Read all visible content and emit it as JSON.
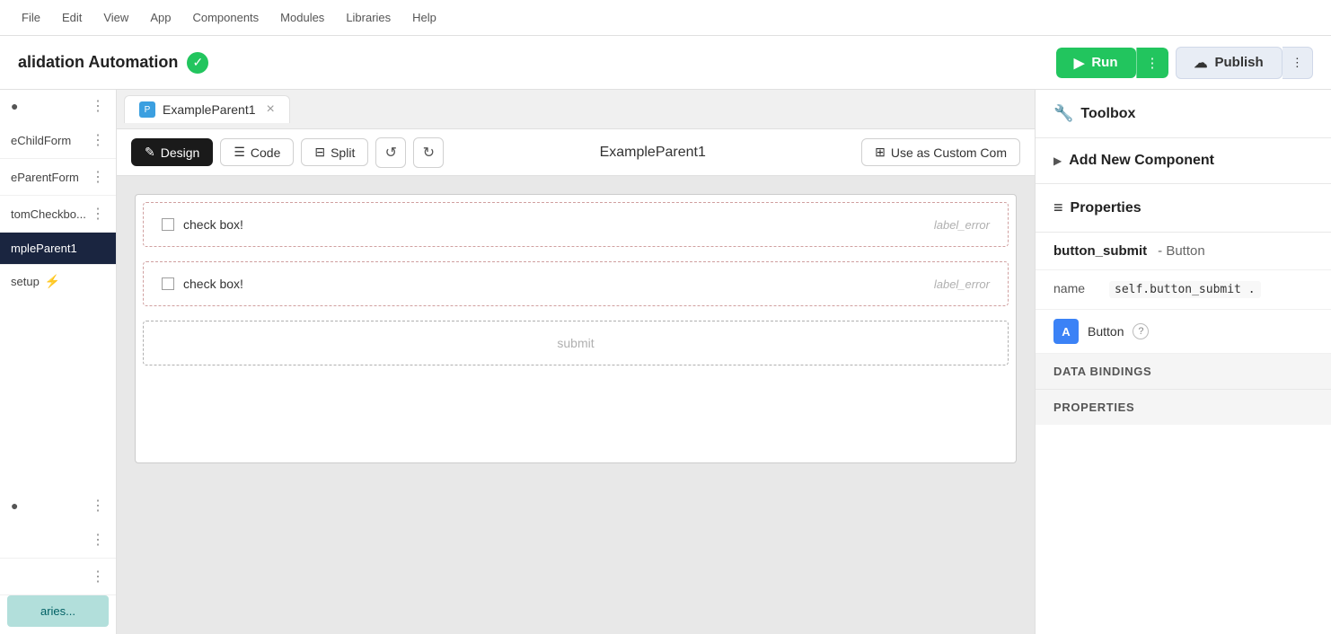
{
  "topNav": {
    "items": [
      "File",
      "Edit",
      "View",
      "App",
      "Components",
      "Modules",
      "Libraries",
      "Help"
    ]
  },
  "header": {
    "title": "alidation Automation",
    "runLabel": "Run",
    "publishLabel": "Publish",
    "moreLabel": "⋮"
  },
  "sidebar": {
    "items": [
      {
        "id": "eChildForm",
        "label": "eChildForm"
      },
      {
        "id": "eParentForm",
        "label": "eParentForm"
      },
      {
        "id": "tomCheckbo",
        "label": "tomCheckbo..."
      },
      {
        "id": "mpleParent1",
        "label": "mpleParent1",
        "active": true
      }
    ],
    "setup": "setup",
    "libraries": "aries..."
  },
  "tabs": [
    {
      "id": "ExampleParent1",
      "label": "ExampleParent1",
      "icon": "P",
      "closable": true
    }
  ],
  "toolbar": {
    "designLabel": "Design",
    "codeLabel": "Code",
    "splitLabel": "Split",
    "undoLabel": "↺",
    "redoLabel": "↻",
    "componentTitle": "ExampleParent1",
    "useAsCustomLabel": "Use as Custom Com"
  },
  "canvas": {
    "rows": [
      {
        "id": "row1",
        "checkboxLabel": "check box!",
        "errorLabel": "label_error"
      },
      {
        "id": "row2",
        "checkboxLabel": "check box!",
        "errorLabel": "label_error"
      }
    ],
    "submitLabel": "submit"
  },
  "rightPanel": {
    "toolboxTitle": "Toolbox",
    "toolboxIcon": "🔧",
    "addNewLabel": "Add New Component",
    "propertiesTitle": "Properties",
    "propertiesIcon": "≡",
    "componentName": "button_submit",
    "componentType": "Button",
    "nameLabel": "name",
    "nameValue": "self.button_submit .",
    "typeBadge": "A",
    "typeLabel": "Button",
    "dataBindingsHeader": "DATA BINDINGS",
    "propertiesHeader": "PROPERTIES"
  }
}
